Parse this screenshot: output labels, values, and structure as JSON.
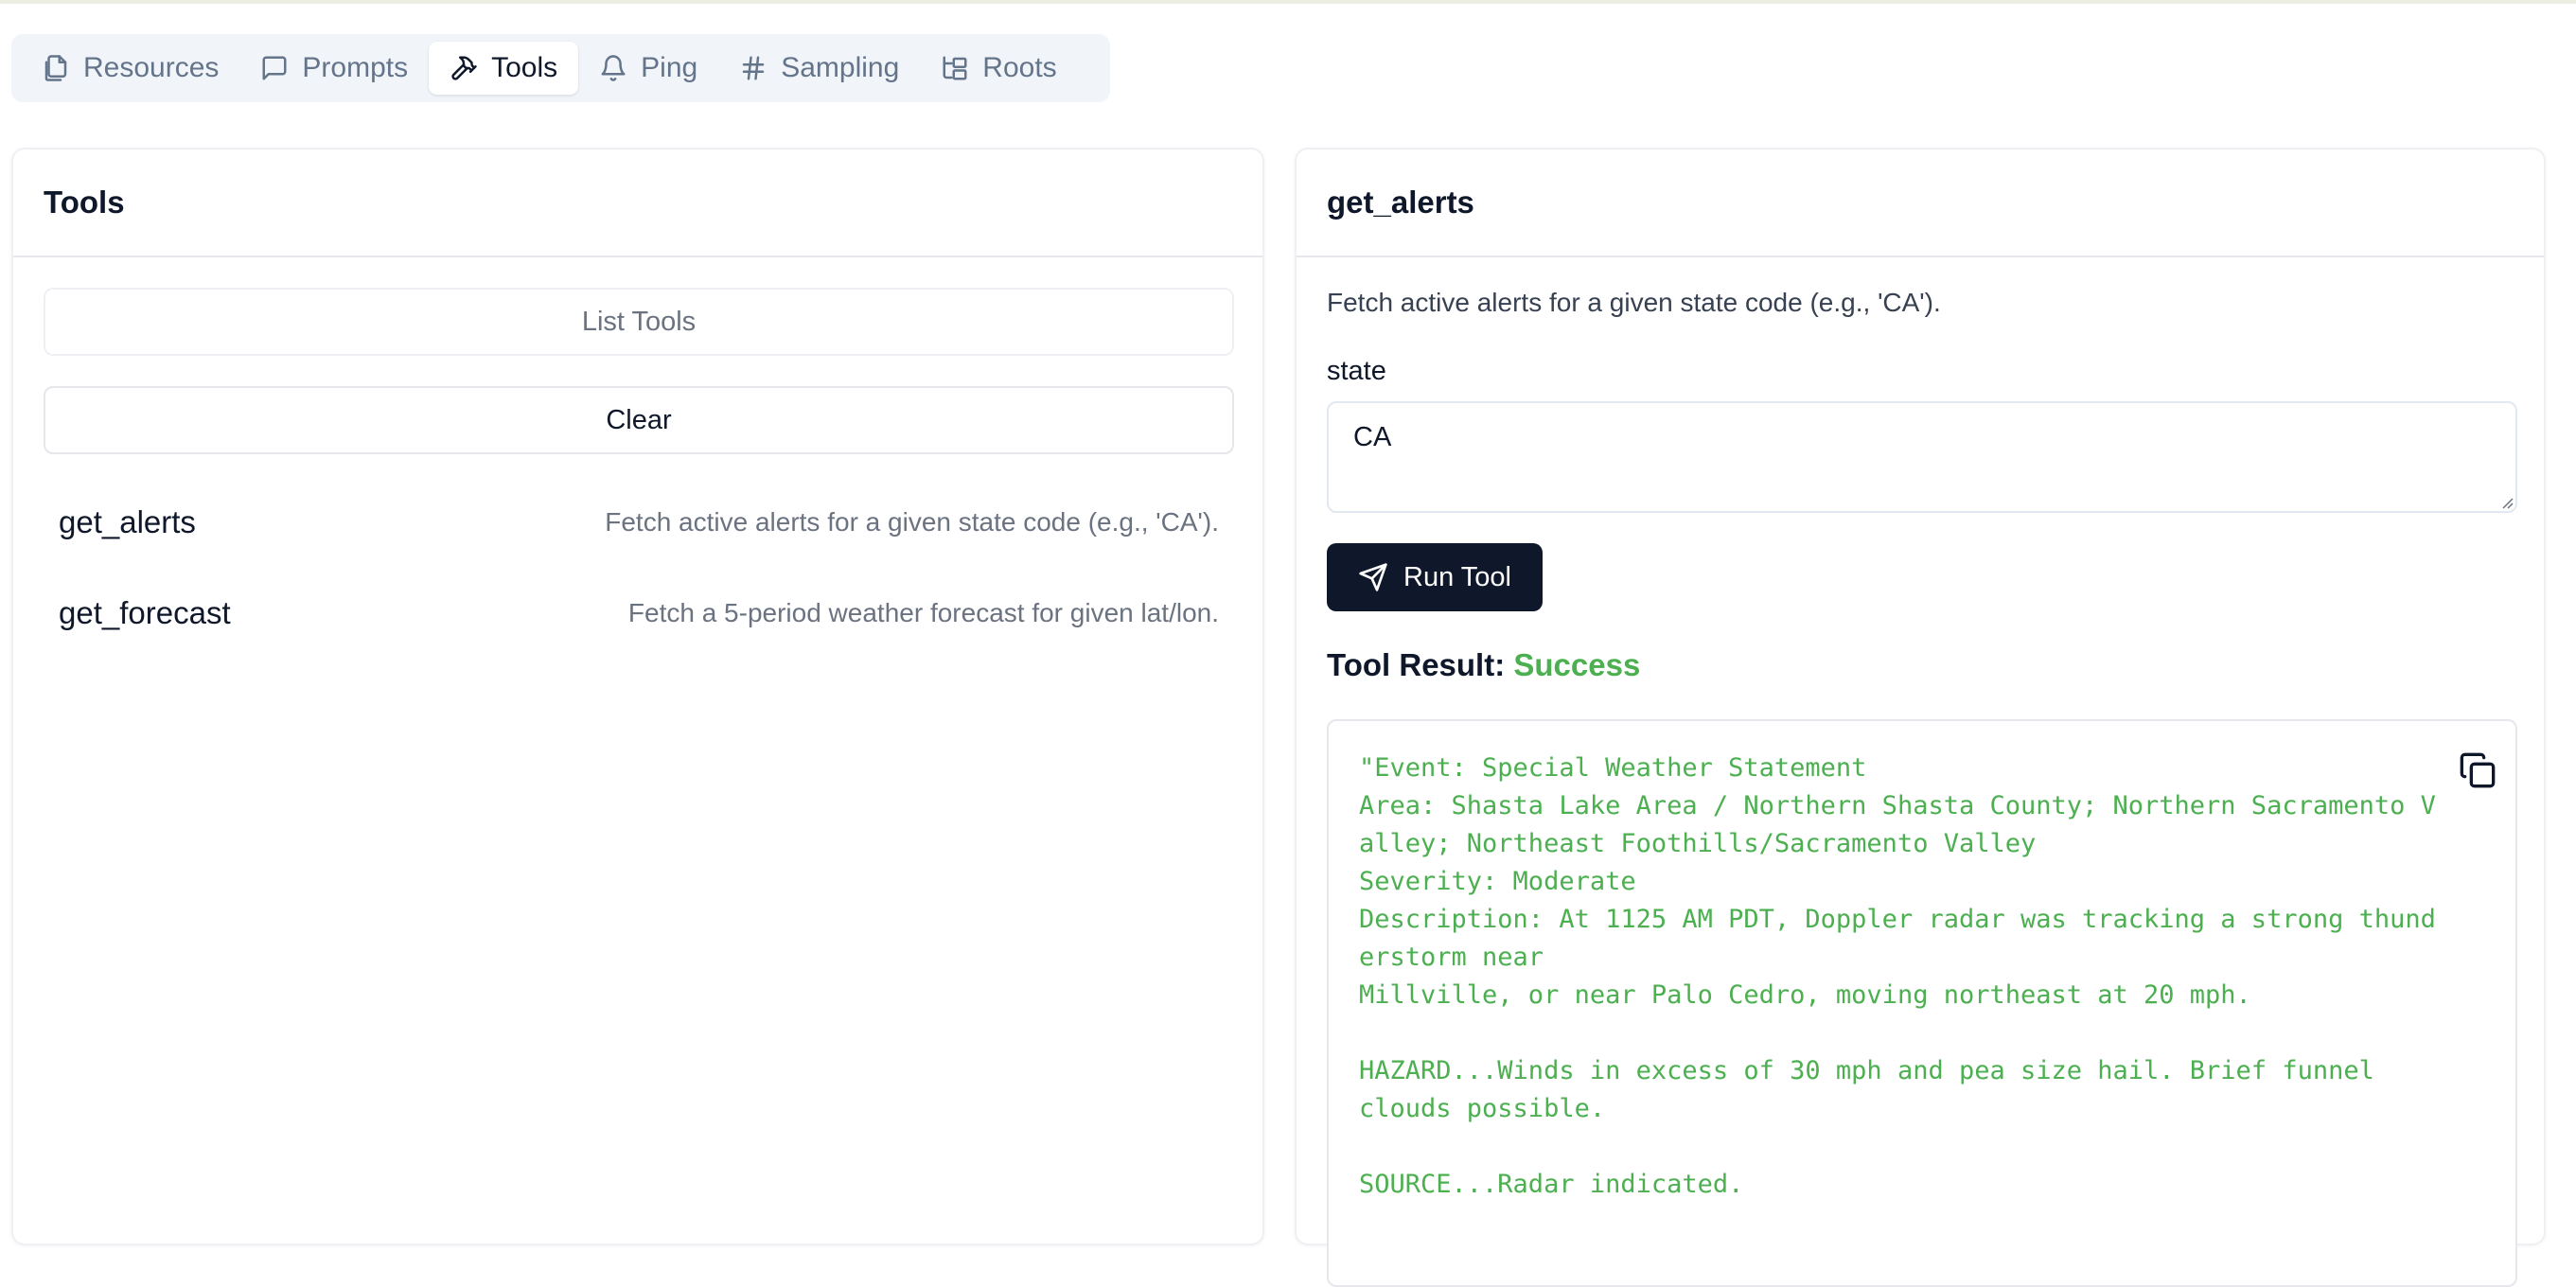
{
  "tabs": [
    {
      "label": "Resources",
      "icon": "files-icon"
    },
    {
      "label": "Prompts",
      "icon": "message-square-icon"
    },
    {
      "label": "Tools",
      "icon": "hammer-icon",
      "active": true
    },
    {
      "label": "Ping",
      "icon": "bell-icon"
    },
    {
      "label": "Sampling",
      "icon": "hash-icon"
    },
    {
      "label": "Roots",
      "icon": "folder-tree-icon"
    }
  ],
  "left_panel": {
    "title": "Tools",
    "list_button": "List Tools",
    "clear_button": "Clear",
    "tools": [
      {
        "name": "get_alerts",
        "description": "Fetch active alerts for a given state code (e.g., 'CA')."
      },
      {
        "name": "get_forecast",
        "description": "Fetch a 5-period weather forecast for given lat/lon."
      }
    ]
  },
  "right_panel": {
    "title": "get_alerts",
    "description": "Fetch active alerts for a given state code (e.g., 'CA').",
    "field_label": "state",
    "field_value": "CA",
    "run_button": "Run Tool",
    "result_label": "Tool Result:",
    "result_status": "Success",
    "result_lines": [
      "\"Event: Special Weather Statement",
      "Area: Shasta Lake Area / Northern Shasta County; Northern Sacramento V",
      "alley; Northeast Foothills/Sacramento Valley",
      "Severity: Moderate",
      "Description: At 1125 AM PDT, Doppler radar was tracking a strong thund",
      "erstorm near",
      "Millville, or near Palo Cedro, moving northeast at 20 mph.",
      "",
      "HAZARD...Winds in excess of 30 mph and pea size hail. Brief funnel",
      "clouds possible.",
      "",
      "SOURCE...Radar indicated."
    ]
  },
  "colors": {
    "accent_dark": "#0f172a",
    "success": "#4caf50",
    "muted": "#64748b"
  }
}
